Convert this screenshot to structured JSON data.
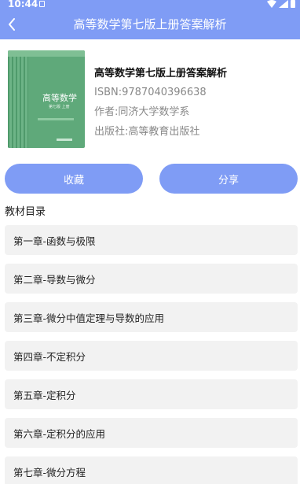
{
  "status_bar": {
    "time": "10:44"
  },
  "header": {
    "title": "高等数学第七版上册答案解析"
  },
  "book": {
    "cover_title": "高等数学",
    "cover_subtitle": "第七版 上册",
    "title": "高等数学第七版上册答案解析",
    "isbn": "ISBN:9787040396638",
    "author": "作者:同济大学数学系",
    "publisher": "出版社:高等教育出版社"
  },
  "actions": {
    "collect_label": "收藏",
    "share_label": "分享"
  },
  "toc": {
    "heading": "教材目录",
    "chapters": [
      "第一章-函数与极限",
      "第二章-导数与微分",
      "第三章-微分中值定理与导数的应用",
      "第四章-不定积分",
      "第五章-定积分",
      "第六章-定积分的应用",
      "第七章-微分方程"
    ]
  },
  "colors": {
    "accent": "#7f9cf5",
    "item_bg": "#f2f2f2",
    "cover": "#5fa97a"
  }
}
